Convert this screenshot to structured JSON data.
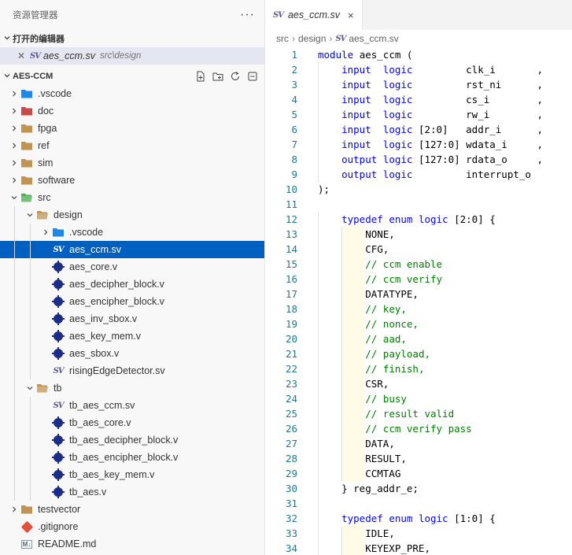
{
  "explorer": {
    "title": "资源管理器",
    "more_label": "···",
    "open_editors_label": "打开的编辑器",
    "open_editor": {
      "icon": "systemverilog-icon",
      "name": "aes_ccm.sv",
      "path": "src\\design"
    },
    "project_label": "AES-CCM"
  },
  "tree": [
    {
      "label": ".vscode",
      "kind": "folder",
      "icon": "vscode-folder-icon",
      "depth": 0,
      "state": "collapsed"
    },
    {
      "label": "doc",
      "kind": "folder",
      "icon": "doc-folder-icon",
      "depth": 0,
      "state": "collapsed"
    },
    {
      "label": "fpga",
      "kind": "folder",
      "icon": "folder-icon",
      "depth": 0,
      "state": "collapsed"
    },
    {
      "label": "ref",
      "kind": "folder",
      "icon": "folder-icon",
      "depth": 0,
      "state": "collapsed"
    },
    {
      "label": "sim",
      "kind": "folder",
      "icon": "folder-icon",
      "depth": 0,
      "state": "collapsed"
    },
    {
      "label": "software",
      "kind": "folder",
      "icon": "folder-icon",
      "depth": 0,
      "state": "collapsed"
    },
    {
      "label": "src",
      "kind": "folder",
      "icon": "src-folder-icon",
      "depth": 0,
      "state": "expanded"
    },
    {
      "label": "design",
      "kind": "folder",
      "icon": "folder-open-icon",
      "depth": 1,
      "state": "expanded"
    },
    {
      "label": ".vscode",
      "kind": "folder",
      "icon": "vscode-folder-icon",
      "depth": 2,
      "state": "collapsed"
    },
    {
      "label": "aes_ccm.sv",
      "kind": "sv",
      "icon": "systemverilog-icon",
      "depth": 2,
      "active": true
    },
    {
      "label": "aes_core.v",
      "kind": "v",
      "icon": "verilog-icon",
      "depth": 2
    },
    {
      "label": "aes_decipher_block.v",
      "kind": "v",
      "icon": "verilog-icon",
      "depth": 2
    },
    {
      "label": "aes_encipher_block.v",
      "kind": "v",
      "icon": "verilog-icon",
      "depth": 2
    },
    {
      "label": "aes_inv_sbox.v",
      "kind": "v",
      "icon": "verilog-icon",
      "depth": 2
    },
    {
      "label": "aes_key_mem.v",
      "kind": "v",
      "icon": "verilog-icon",
      "depth": 2
    },
    {
      "label": "aes_sbox.v",
      "kind": "v",
      "icon": "verilog-icon",
      "depth": 2
    },
    {
      "label": "risingEdgeDetector.sv",
      "kind": "sv",
      "icon": "systemverilog-icon",
      "depth": 2
    },
    {
      "label": "tb",
      "kind": "folder",
      "icon": "folder-open-icon",
      "depth": 1,
      "state": "expanded"
    },
    {
      "label": "tb_aes_ccm.sv",
      "kind": "sv",
      "icon": "systemverilog-icon",
      "depth": 2
    },
    {
      "label": "tb_aes_core.v",
      "kind": "v",
      "icon": "verilog-icon",
      "depth": 2
    },
    {
      "label": "tb_aes_decipher_block.v",
      "kind": "v",
      "icon": "verilog-icon",
      "depth": 2
    },
    {
      "label": "tb_aes_encipher_block.v",
      "kind": "v",
      "icon": "verilog-icon",
      "depth": 2
    },
    {
      "label": "tb_aes_key_mem.v",
      "kind": "v",
      "icon": "verilog-icon",
      "depth": 2
    },
    {
      "label": "tb_aes.v",
      "kind": "v",
      "icon": "verilog-icon",
      "depth": 2
    },
    {
      "label": "testvector",
      "kind": "folder",
      "icon": "folder-icon",
      "depth": 0,
      "state": "collapsed"
    },
    {
      "label": ".gitignore",
      "kind": "git",
      "icon": "git-icon",
      "depth": 0
    },
    {
      "label": "README.md",
      "kind": "md",
      "icon": "markdown-icon",
      "depth": 0
    }
  ],
  "editor": {
    "tab": {
      "icon": "systemverilog-icon",
      "name": "aes_ccm.sv",
      "close": "×"
    },
    "breadcrumb": [
      "src",
      "design"
    ],
    "breadcrumb_file": "aes_ccm.sv",
    "lines": [
      {
        "n": "1",
        "t": [
          [
            "kw",
            "module "
          ],
          [
            "tx",
            "aes_ccm ("
          ]
        ]
      },
      {
        "n": "2",
        "t": [
          [
            "tx",
            "    "
          ],
          [
            "kw",
            "input  logic         "
          ],
          [
            "tx",
            "clk_i       ,"
          ]
        ]
      },
      {
        "n": "3",
        "t": [
          [
            "tx",
            "    "
          ],
          [
            "kw",
            "input  logic         "
          ],
          [
            "tx",
            "rst_ni      ,"
          ]
        ]
      },
      {
        "n": "4",
        "t": [
          [
            "tx",
            "    "
          ],
          [
            "kw",
            "input  logic         "
          ],
          [
            "tx",
            "cs_i        ,"
          ]
        ]
      },
      {
        "n": "5",
        "t": [
          [
            "tx",
            "    "
          ],
          [
            "kw",
            "input  logic         "
          ],
          [
            "tx",
            "rw_i        ,"
          ]
        ]
      },
      {
        "n": "6",
        "t": [
          [
            "tx",
            "    "
          ],
          [
            "kw",
            "input  logic "
          ],
          [
            "tx",
            "[2:0]   addr_i      ,"
          ]
        ]
      },
      {
        "n": "7",
        "t": [
          [
            "tx",
            "    "
          ],
          [
            "kw",
            "input  logic "
          ],
          [
            "tx",
            "[127:0] wdata_i     ,"
          ]
        ]
      },
      {
        "n": "8",
        "t": [
          [
            "tx",
            "    "
          ],
          [
            "kw",
            "output logic "
          ],
          [
            "tx",
            "[127:0] rdata_o     ,"
          ]
        ]
      },
      {
        "n": "9",
        "t": [
          [
            "tx",
            "    "
          ],
          [
            "kw",
            "output logic         "
          ],
          [
            "tx",
            "interrupt_o"
          ]
        ]
      },
      {
        "n": "10",
        "t": [
          [
            "tx",
            ");"
          ]
        ]
      },
      {
        "n": "11",
        "t": []
      },
      {
        "n": "12",
        "t": [
          [
            "tx",
            "    "
          ],
          [
            "kw",
            "typedef enum logic "
          ],
          [
            "tx",
            "[2:0] {"
          ]
        ]
      },
      {
        "n": "13",
        "t": [
          [
            "tx",
            "        NONE,"
          ]
        ]
      },
      {
        "n": "14",
        "t": [
          [
            "tx",
            "        CFG,"
          ]
        ]
      },
      {
        "n": "15",
        "t": [
          [
            "tx",
            "        "
          ],
          [
            "cm",
            "// ccm enable"
          ]
        ]
      },
      {
        "n": "16",
        "t": [
          [
            "tx",
            "        "
          ],
          [
            "cm",
            "// ccm verify"
          ]
        ]
      },
      {
        "n": "17",
        "t": [
          [
            "tx",
            "        DATATYPE,"
          ]
        ]
      },
      {
        "n": "18",
        "t": [
          [
            "tx",
            "        "
          ],
          [
            "cm",
            "// key,"
          ]
        ]
      },
      {
        "n": "19",
        "t": [
          [
            "tx",
            "        "
          ],
          [
            "cm",
            "// nonce,"
          ]
        ]
      },
      {
        "n": "20",
        "t": [
          [
            "tx",
            "        "
          ],
          [
            "cm",
            "// aad,"
          ]
        ]
      },
      {
        "n": "21",
        "t": [
          [
            "tx",
            "        "
          ],
          [
            "cm",
            "// payload,"
          ]
        ]
      },
      {
        "n": "22",
        "t": [
          [
            "tx",
            "        "
          ],
          [
            "cm",
            "// finish,"
          ]
        ]
      },
      {
        "n": "23",
        "t": [
          [
            "tx",
            "        CSR,"
          ]
        ]
      },
      {
        "n": "24",
        "t": [
          [
            "tx",
            "        "
          ],
          [
            "cm",
            "// busy"
          ]
        ]
      },
      {
        "n": "25",
        "t": [
          [
            "tx",
            "        "
          ],
          [
            "cm",
            "// result valid"
          ]
        ]
      },
      {
        "n": "26",
        "t": [
          [
            "tx",
            "        "
          ],
          [
            "cm",
            "// ccm verify pass"
          ]
        ]
      },
      {
        "n": "27",
        "t": [
          [
            "tx",
            "        DATA,"
          ]
        ]
      },
      {
        "n": "28",
        "t": [
          [
            "tx",
            "        RESULT,"
          ]
        ]
      },
      {
        "n": "29",
        "t": [
          [
            "tx",
            "        CCMTAG"
          ]
        ]
      },
      {
        "n": "30",
        "t": [
          [
            "tx",
            "    } reg_addr_e;"
          ]
        ]
      },
      {
        "n": "31",
        "t": []
      },
      {
        "n": "32",
        "t": [
          [
            "tx",
            "    "
          ],
          [
            "kw",
            "typedef enum logic "
          ],
          [
            "tx",
            "[1:0] {"
          ]
        ]
      },
      {
        "n": "33",
        "t": [
          [
            "tx",
            "        IDLE,"
          ]
        ]
      },
      {
        "n": "34",
        "t": [
          [
            "tx",
            "        KEYEXP_PRE,"
          ]
        ]
      }
    ]
  },
  "colors": {
    "active_row": "#0060c0",
    "keyword": "#0000ff",
    "comment": "#008000",
    "line_number": "#237893"
  }
}
